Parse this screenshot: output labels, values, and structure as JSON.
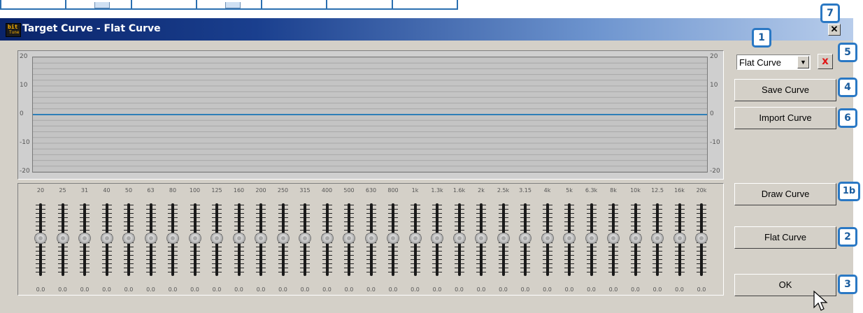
{
  "window": {
    "title": "Target Curve - Flat Curve",
    "app_icon_top": "bit",
    "app_icon_bottom": "Tune",
    "close_label": "✕"
  },
  "graph": {
    "y_labels_left": [
      "20",
      "10",
      "0",
      "-10",
      "-20"
    ],
    "y_labels_right": [
      "20",
      "10",
      "0",
      "-10",
      "-20"
    ],
    "y_range": [
      -20,
      20
    ],
    "curve_value": 0,
    "curve_color": "#2e7fb8"
  },
  "eq": {
    "frequencies": [
      "20",
      "25",
      "31",
      "40",
      "50",
      "63",
      "80",
      "100",
      "125",
      "160",
      "200",
      "250",
      "315",
      "400",
      "500",
      "630",
      "800",
      "1k",
      "1.3k",
      "1.6k",
      "2k",
      "2.5k",
      "3.15",
      "4k",
      "5k",
      "6.3k",
      "8k",
      "10k",
      "12.5",
      "16k",
      "20k"
    ],
    "values": [
      "0.0",
      "0.0",
      "0.0",
      "0.0",
      "0.0",
      "0.0",
      "0.0",
      "0.0",
      "0.0",
      "0.0",
      "0.0",
      "0.0",
      "0.0",
      "0.0",
      "0.0",
      "0.0",
      "0.0",
      "0.0",
      "0.0",
      "0.0",
      "0.0",
      "0.0",
      "0.0",
      "0.0",
      "0.0",
      "0.0",
      "0.0",
      "0.0",
      "0.0",
      "0.0",
      "0.0"
    ]
  },
  "controls": {
    "curve_select": "Flat Curve",
    "delete_label": "x",
    "save_curve": "Save Curve",
    "import_curve": "Import Curve",
    "draw_curve": "Draw Curve",
    "flat_curve": "Flat Curve",
    "ok": "OK"
  },
  "callouts": [
    "1",
    "5",
    "4",
    "6",
    "7",
    "1b",
    "2",
    "3"
  ],
  "colors": {
    "callout_border": "#2a78c4",
    "title_bar": "#0a246a"
  }
}
